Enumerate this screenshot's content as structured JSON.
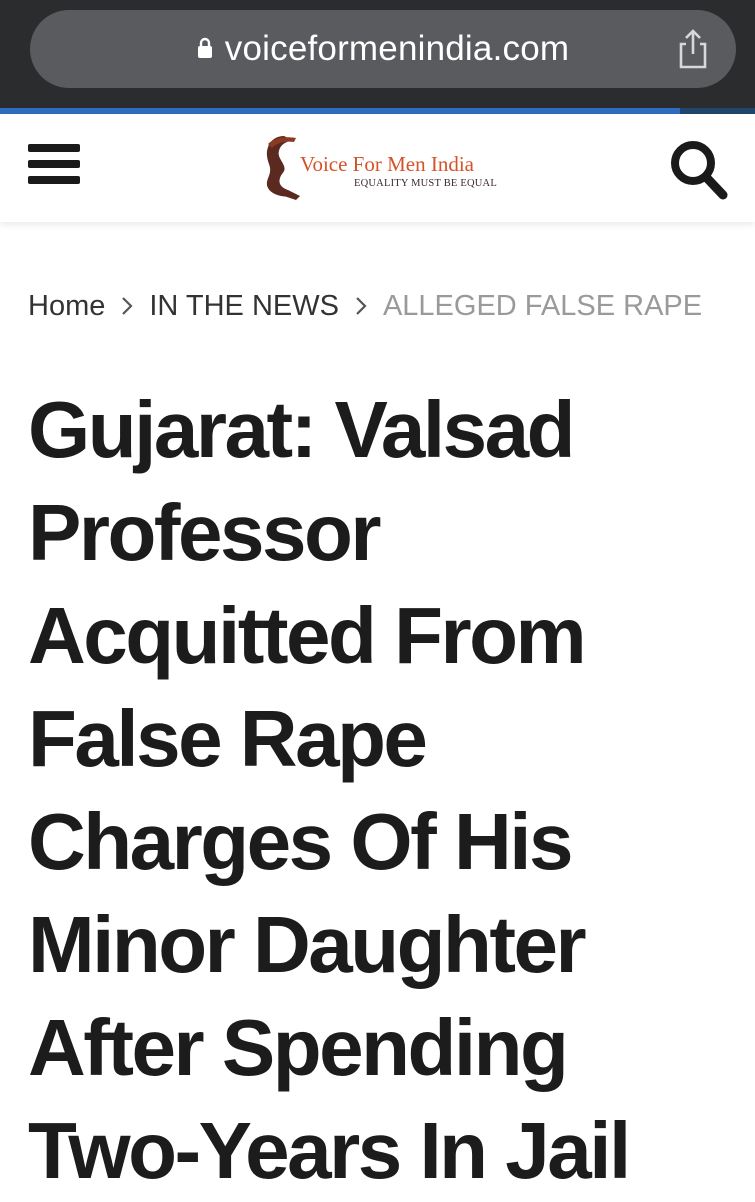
{
  "browser": {
    "url": "voiceformenindia.com",
    "load_progress": 0.9
  },
  "header": {
    "logo_title": "Voice For Men India",
    "logo_tagline": "EQUALITY MUST BE EQUAL"
  },
  "breadcrumb": {
    "items": [
      "Home",
      "IN THE NEWS",
      "ALLEGED FALSE RAPE"
    ]
  },
  "article": {
    "title": "Gujarat: Valsad Professor Acquitted From False Rape Charges Of His Minor Daughter After Spending Two-Years In Jail"
  },
  "colors": {
    "chrome_bg": "#2b2c2e",
    "url_pill": "#5a5b5e",
    "logo_accent": "#d4542a",
    "breadcrumb_current": "#9a9a9a"
  }
}
